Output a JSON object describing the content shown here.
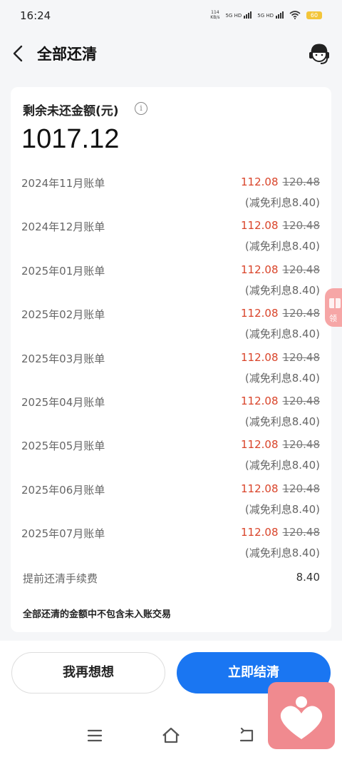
{
  "status_bar": {
    "time": "16:24",
    "net_speed_top": "114",
    "net_speed_bottom": "KB/s",
    "sim1": "5G HD",
    "sim2": "5G HD",
    "battery": "60"
  },
  "header": {
    "title": "全部还清"
  },
  "summary": {
    "remaining_label": "剩余未还金额(元)",
    "remaining_amount": "1017.12"
  },
  "bills": [
    {
      "name": "2024年11月账单",
      "amount": "112.08",
      "original": "120.48",
      "discount": "(减免利息8.40)"
    },
    {
      "name": "2024年12月账单",
      "amount": "112.08",
      "original": "120.48",
      "discount": "(减免利息8.40)"
    },
    {
      "name": "2025年01月账单",
      "amount": "112.08",
      "original": "120.48",
      "discount": "(减免利息8.40)"
    },
    {
      "name": "2025年02月账单",
      "amount": "112.08",
      "original": "120.48",
      "discount": "(减免利息8.40)"
    },
    {
      "name": "2025年03月账单",
      "amount": "112.08",
      "original": "120.48",
      "discount": "(减免利息8.40)"
    },
    {
      "name": "2025年04月账单",
      "amount": "112.08",
      "original": "120.48",
      "discount": "(减免利息8.40)"
    },
    {
      "name": "2025年05月账单",
      "amount": "112.08",
      "original": "120.48",
      "discount": "(减免利息8.40)"
    },
    {
      "name": "2025年06月账单",
      "amount": "112.08",
      "original": "120.48",
      "discount": "(减免利息8.40)"
    },
    {
      "name": "2025年07月账单",
      "amount": "112.08",
      "original": "120.48",
      "discount": "(减免利息8.40)"
    }
  ],
  "fee": {
    "label": "提前还清手续费",
    "value": "8.40"
  },
  "notice": "全部还清的金额中不包含未入账交易",
  "float_badge": "领",
  "actions": {
    "secondary": "我再想想",
    "primary": "立即结清"
  },
  "colors": {
    "accent_blue": "#1a76f2",
    "discount_red": "#d9442a"
  }
}
